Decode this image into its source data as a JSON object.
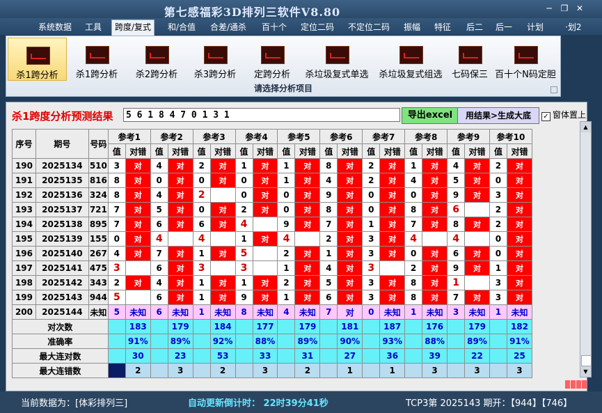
{
  "window": {
    "title": "第七感福彩3D排列三软件V8.80"
  },
  "menu": [
    "系统数据",
    "工具",
    "跨度/复式",
    "和/合值",
    "合差/通杀",
    "百十个",
    "定位二码",
    "不定位二码",
    "振幅",
    "特征",
    "后二",
    "后一",
    "计划",
    "·划2"
  ],
  "ribbon": {
    "buttons": [
      "杀1跨分析",
      "杀1跨分析",
      "杀2跨分析",
      "杀3跨分析",
      "定跨分析",
      "杀垃圾复式单选",
      "杀垃圾复式组选",
      "七码保三",
      "百十个N码定胆"
    ],
    "group_label": "请选择分析项目"
  },
  "result": {
    "title": "杀1跨度分析预测结果",
    "value": "5 6 1 8 4 7 0 1 3 1",
    "excel_button": "导出excel",
    "generate_button": "用结果>生成大底",
    "checkbox_label": "窗体置上",
    "checkbox_checked": true
  },
  "grid": {
    "headers": {
      "seq": "序号",
      "issue": "期号",
      "code": "号码",
      "value": "值",
      "check": "对错"
    },
    "refs": [
      "参考1",
      "参考2",
      "参考3",
      "参考4",
      "参考5",
      "参考6",
      "参考7",
      "参考8",
      "参考9",
      "参考10"
    ],
    "rows": [
      {
        "seq": "190",
        "issue": "2025134",
        "code": "510",
        "vals": [
          "3",
          "4",
          "2",
          "1",
          "1",
          "8",
          "2",
          "1",
          "4",
          "2"
        ],
        "marks": [
          "对",
          "对",
          "对",
          "对",
          "对",
          "对",
          "对",
          "对",
          "对",
          "对"
        ],
        "miss": [
          false,
          false,
          false,
          false,
          false,
          false,
          false,
          false,
          false,
          false
        ]
      },
      {
        "seq": "191",
        "issue": "2025135",
        "code": "816",
        "vals": [
          "8",
          "0",
          "0",
          "0",
          "1",
          "4",
          "2",
          "4",
          "5",
          "0"
        ],
        "marks": [
          "对",
          "对",
          "对",
          "对",
          "对",
          "对",
          "对",
          "对",
          "对",
          "对"
        ],
        "miss": [
          false,
          false,
          false,
          false,
          false,
          false,
          false,
          false,
          false,
          false
        ]
      },
      {
        "seq": "192",
        "issue": "2025136",
        "code": "324",
        "vals": [
          "8",
          "4",
          "2",
          "0",
          "0",
          "9",
          "0",
          "0",
          "9",
          "3"
        ],
        "marks": [
          "对",
          "对",
          "",
          "对",
          "对",
          "对",
          "对",
          "对",
          "对",
          "对"
        ],
        "miss": [
          false,
          false,
          true,
          false,
          false,
          false,
          false,
          false,
          false,
          false
        ]
      },
      {
        "seq": "193",
        "issue": "2025137",
        "code": "721",
        "vals": [
          "7",
          "5",
          "0",
          "2",
          "0",
          "8",
          "0",
          "8",
          "6",
          "2"
        ],
        "marks": [
          "对",
          "对",
          "对",
          "对",
          "对",
          "对",
          "对",
          "对",
          "",
          "对"
        ],
        "miss": [
          false,
          false,
          false,
          false,
          false,
          false,
          false,
          false,
          true,
          false
        ]
      },
      {
        "seq": "194",
        "issue": "2025138",
        "code": "895",
        "vals": [
          "7",
          "6",
          "6",
          "4",
          "9",
          "7",
          "1",
          "7",
          "8",
          "2"
        ],
        "marks": [
          "对",
          "对",
          "对",
          "",
          "对",
          "对",
          "对",
          "对",
          "对",
          "对"
        ],
        "miss": [
          false,
          false,
          false,
          true,
          false,
          false,
          false,
          false,
          false,
          false
        ]
      },
      {
        "seq": "195",
        "issue": "2025139",
        "code": "155",
        "vals": [
          "0",
          "4",
          "4",
          "1",
          "4",
          "2",
          "3",
          "4",
          "4",
          "0"
        ],
        "marks": [
          "对",
          "",
          "",
          "对",
          "",
          "对",
          "对",
          "",
          "",
          "对"
        ],
        "miss": [
          false,
          true,
          true,
          false,
          true,
          false,
          false,
          true,
          true,
          false
        ]
      },
      {
        "seq": "196",
        "issue": "2025140",
        "code": "267",
        "vals": [
          "4",
          "7",
          "1",
          "5",
          "2",
          "1",
          "3",
          "0",
          "6",
          "0"
        ],
        "marks": [
          "对",
          "对",
          "对",
          "",
          "对",
          "对",
          "对",
          "对",
          "对",
          "对"
        ],
        "miss": [
          false,
          false,
          false,
          true,
          false,
          false,
          false,
          false,
          false,
          false
        ]
      },
      {
        "seq": "197",
        "issue": "2025141",
        "code": "475",
        "vals": [
          "3",
          "6",
          "3",
          "3",
          "1",
          "4",
          "3",
          "2",
          "9",
          "1"
        ],
        "marks": [
          "",
          "对",
          "",
          "",
          "对",
          "对",
          "",
          "对",
          "对",
          "对"
        ],
        "miss": [
          true,
          false,
          true,
          true,
          false,
          false,
          true,
          false,
          false,
          false
        ]
      },
      {
        "seq": "198",
        "issue": "2025142",
        "code": "343",
        "vals": [
          "2",
          "4",
          "1",
          "1",
          "2",
          "5",
          "3",
          "8",
          "1",
          "3"
        ],
        "marks": [
          "对",
          "对",
          "对",
          "对",
          "对",
          "对",
          "对",
          "对",
          "",
          "对"
        ],
        "miss": [
          false,
          false,
          false,
          false,
          false,
          false,
          false,
          false,
          true,
          false
        ]
      },
      {
        "seq": "199",
        "issue": "2025143",
        "code": "944",
        "vals": [
          "5",
          "6",
          "1",
          "9",
          "1",
          "6",
          "3",
          "8",
          "7",
          "3"
        ],
        "marks": [
          "",
          "对",
          "对",
          "对",
          "对",
          "对",
          "对",
          "对",
          "对",
          "对"
        ],
        "miss": [
          true,
          false,
          false,
          false,
          false,
          false,
          false,
          false,
          false,
          false
        ]
      },
      {
        "seq": "200",
        "issue": "2025144",
        "code": "未知",
        "vals": [
          "5",
          "6",
          "1",
          "8",
          "4",
          "7",
          "0",
          "1",
          "3",
          "1"
        ],
        "marks": [
          "未知",
          "未知",
          "未知",
          "未知",
          "未知",
          "对",
          "未知",
          "未知",
          "未知",
          "未知"
        ],
        "miss": [
          false,
          false,
          false,
          false,
          false,
          false,
          false,
          false,
          false,
          false
        ]
      }
    ],
    "stats": [
      {
        "label": "对次数",
        "values": [
          "183",
          "179",
          "184",
          "177",
          "179",
          "181",
          "187",
          "176",
          "179",
          "182"
        ]
      },
      {
        "label": "准确率",
        "values": [
          "91%",
          "89%",
          "92%",
          "88%",
          "89%",
          "90%",
          "93%",
          "88%",
          "89%",
          "91%"
        ]
      },
      {
        "label": "最大连对数",
        "values": [
          "30",
          "23",
          "53",
          "33",
          "31",
          "27",
          "36",
          "39",
          "22",
          "25"
        ]
      },
      {
        "label": "最大连错数",
        "values": [
          "2",
          "3",
          "2",
          "3",
          "2",
          "1",
          "1",
          "3",
          "3",
          "3"
        ]
      }
    ]
  },
  "status": {
    "current_data": "当前数据为：[体彩排列三]",
    "countdown": "自动更新倒计时： 22时39分41秒",
    "issue_info": "TCP3第 2025143 期开：【944】【746】"
  }
}
